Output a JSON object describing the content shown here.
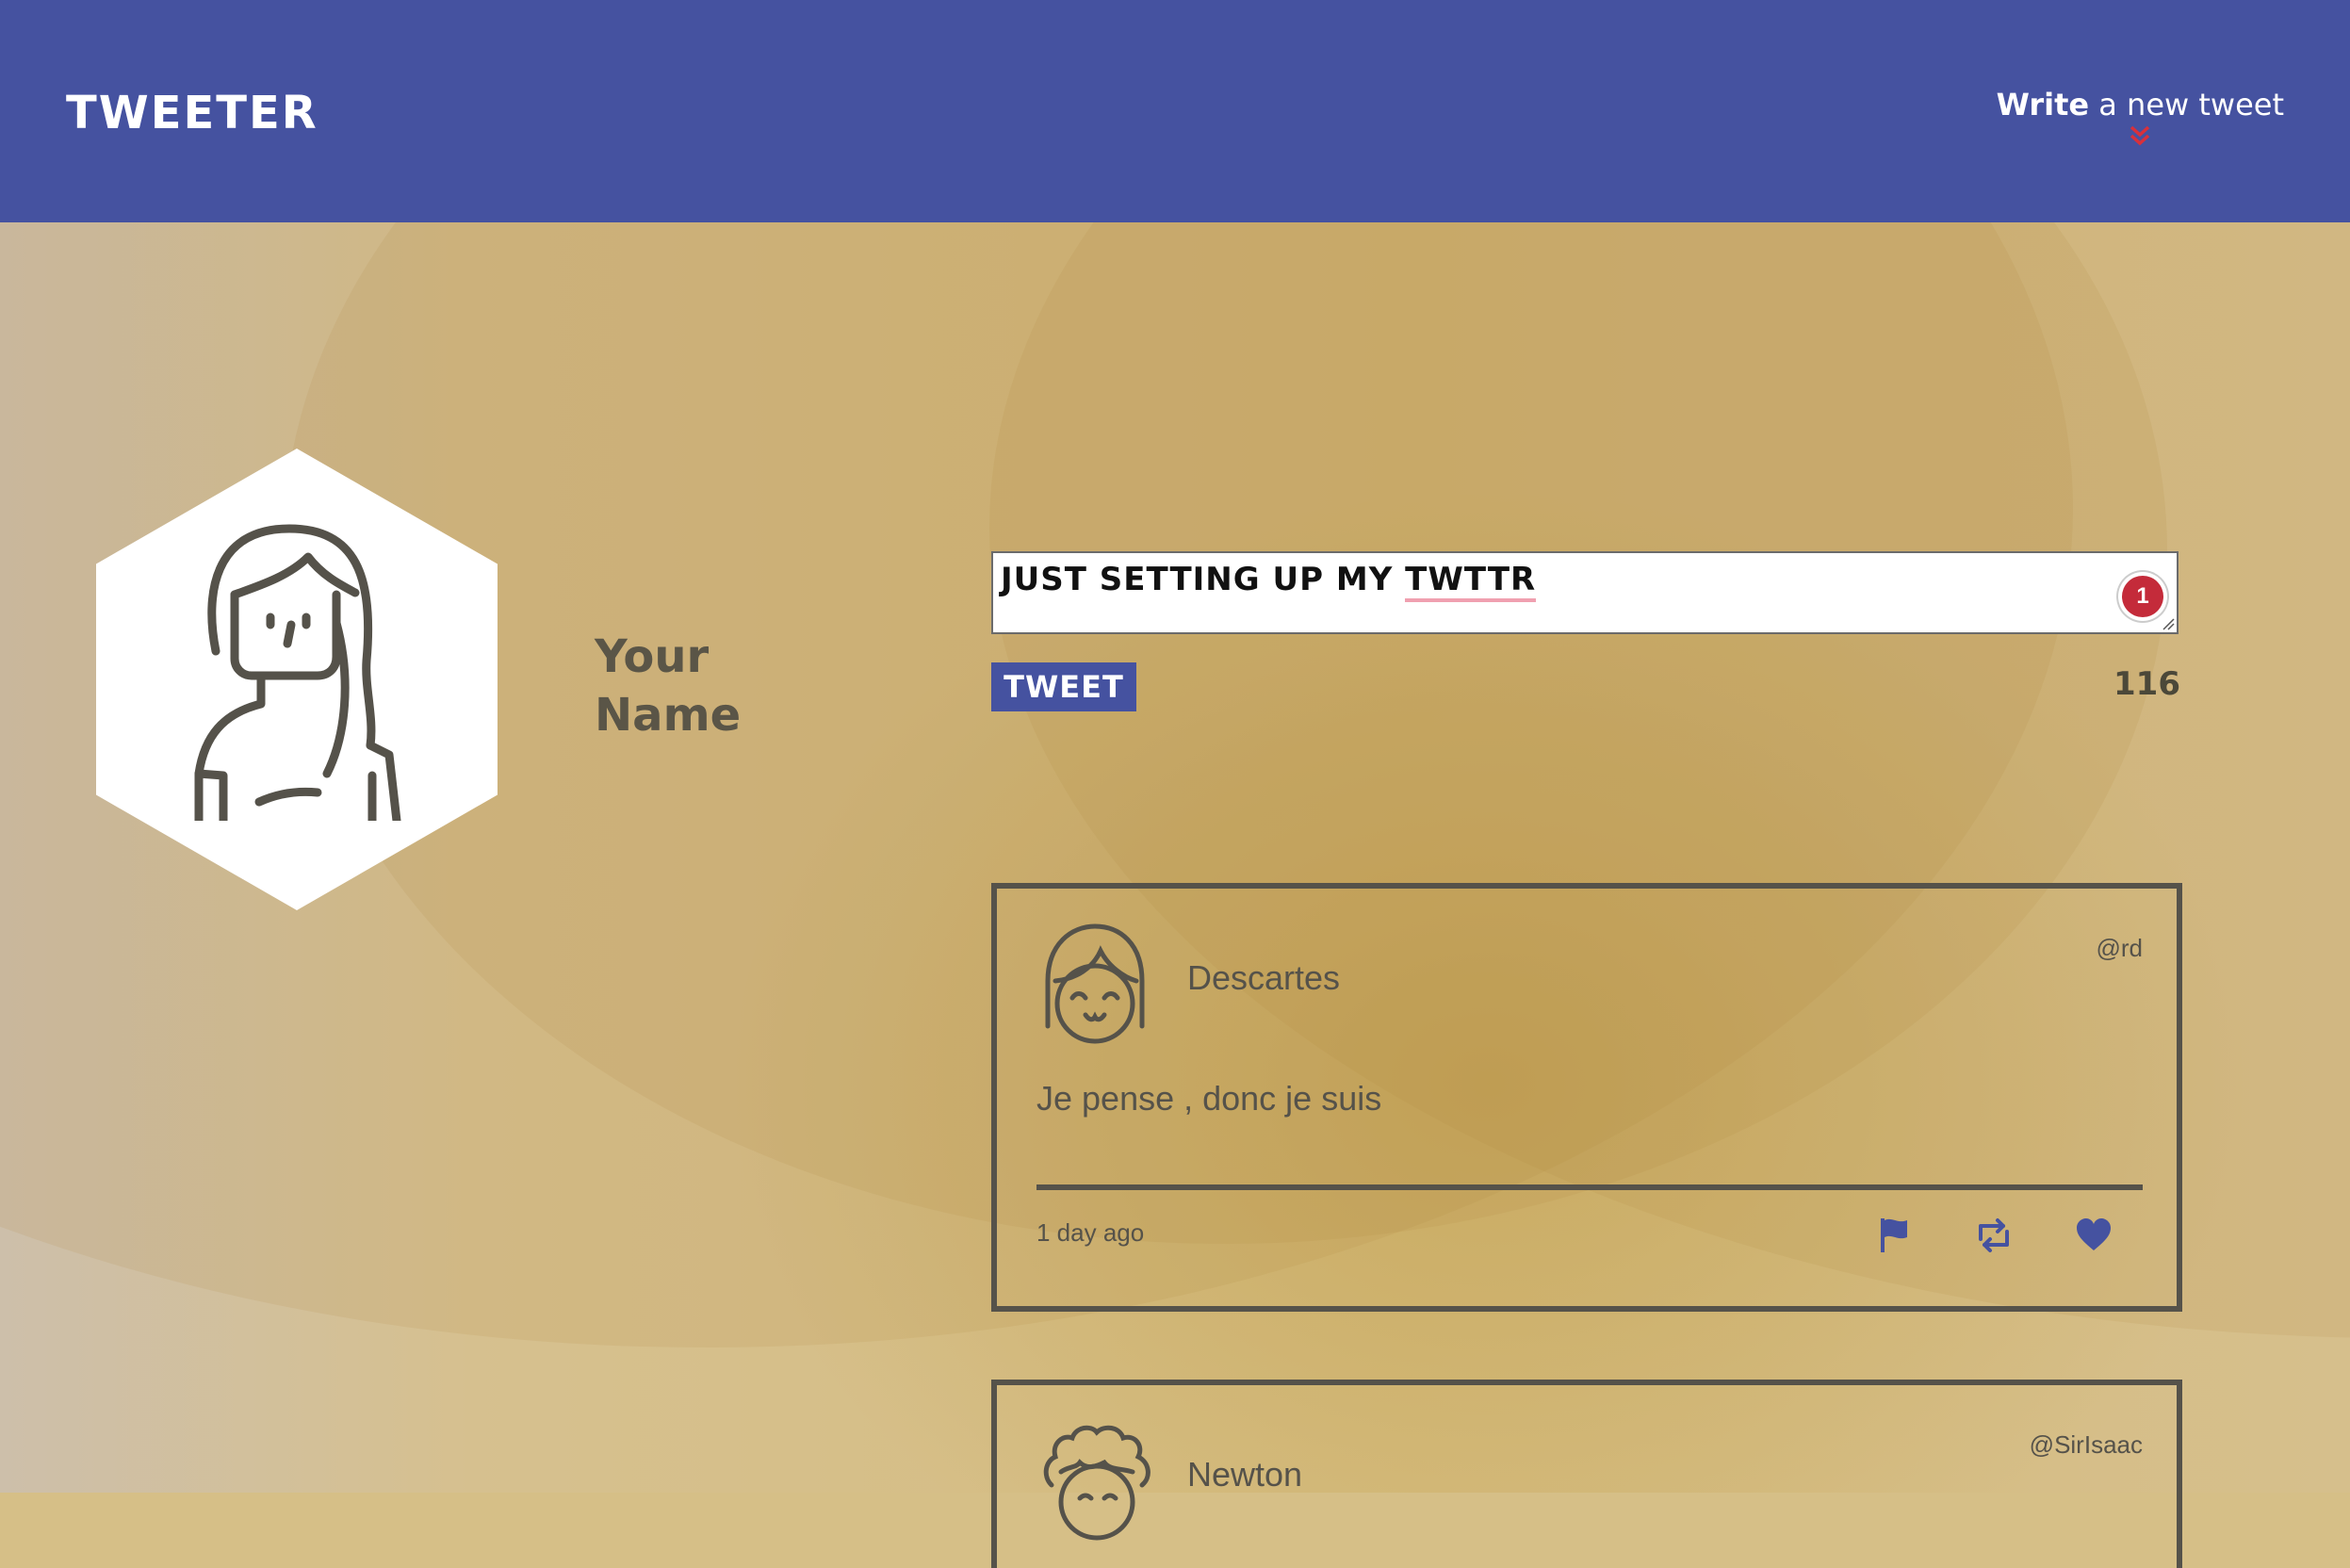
{
  "nav": {
    "logo": "TWEETER",
    "compose_bold": "Write",
    "compose_rest": " a new tweet",
    "compose_icon": "double-chevron-down-icon"
  },
  "profile": {
    "name_line1": "Your",
    "name_line2": "Name",
    "avatar_icon": "woman-avatar-icon"
  },
  "composer": {
    "text_before": "JUST SETTING UP MY ",
    "text_misspelled": "TWTTR",
    "error_count": "1",
    "button_label": "TWEET",
    "char_counter": "116"
  },
  "tweets": [
    {
      "name": "Descartes",
      "handle": "@rd",
      "body": "Je pense , donc je suis",
      "time": "1 day ago",
      "avatar_icon": "girl-avatar-icon"
    },
    {
      "name": "Newton",
      "handle": "@SirIsaac",
      "avatar_icon": "curly-hair-avatar-icon"
    }
  ],
  "actions": [
    "flag-icon",
    "retweet-icon",
    "heart-icon"
  ],
  "colors": {
    "nav": "#4552a0",
    "accent": "#4552a0",
    "error": "#c42b3a",
    "text": "#55524a",
    "background": "#d6bf87"
  }
}
